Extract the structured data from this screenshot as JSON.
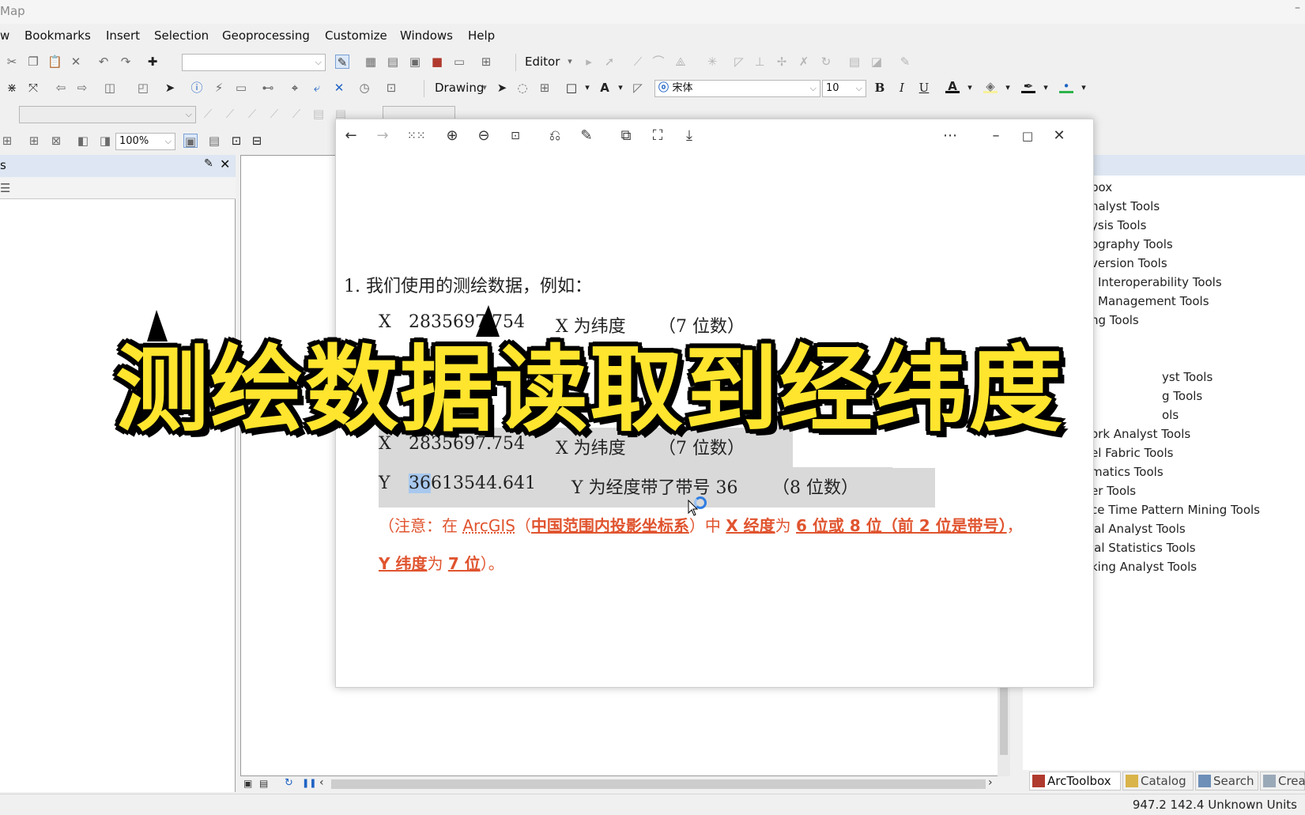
{
  "window": {
    "title": "Map",
    "minimize_glyph": "–"
  },
  "menu": [
    "w",
    "Bookmarks",
    "Insert",
    "Selection",
    "Geoprocessing",
    "Customize",
    "Windows",
    "Help"
  ],
  "toolbar": {
    "editor_label": "Editor",
    "drawing_label": "Drawing",
    "font_name": "宋体",
    "font_size": "10",
    "bold": "B",
    "italic": "I",
    "underline": "U",
    "zoom_percent": "100%"
  },
  "left_panel": {
    "title": "s"
  },
  "toolbox": {
    "items": [
      "box",
      "nalyst Tools",
      "ysis Tools",
      "ography Tools",
      "version Tools",
      "Interoperability Tools",
      "Management Tools",
      "ng Tools",
      "yst Tools",
      "g Tools",
      "ols",
      "ork Analyst Tools",
      "el Fabric Tools",
      "matics Tools",
      "er Tools",
      "ce Time Pattern Mining Tools",
      "ial Analyst Tools",
      "ial Statistics Tools",
      "king Analyst Tools"
    ],
    "tabs": [
      "ArcToolbox",
      "Catalog",
      "Search",
      "Crea"
    ]
  },
  "status": {
    "coords": "947.2  142.4 Unknown Units"
  },
  "document": {
    "line1": "1.   我们使用的测绘数据，例如：",
    "x_label": "X",
    "x_value": "2835697.754",
    "x_desc": "X 为纬度",
    "x_digits": "（7 位数）",
    "x2_value": "2835697.754",
    "x2_desc": "X 为纬度",
    "x2_digits": "（7 位数）",
    "y_label": "Y",
    "y_value_sel": "36",
    "y_value_rest": "613544.641",
    "y_desc": "Y 为经度带了带号 36",
    "y_digits": "（8 位数）",
    "note_1a": "（注意：在 ",
    "note_1b": "ArcGIS",
    "note_1c": "（",
    "note_1d": "中国范围内投影坐标系",
    "note_1e": "）中 ",
    "note_1f": "X 经度",
    "note_1g": "为 ",
    "note_1h": "6 位或 8 位（前 2 位是带号）",
    "note_1i": "，",
    "note_2a": "Y 纬度",
    "note_2b": "为 ",
    "note_2c": "7 位",
    "note_2d": "）。"
  },
  "banner": {
    "text": "测绘数据读取到经纬度"
  },
  "colors": {
    "banner": "#ffe52e",
    "note": "#e0542f",
    "selection": "#a8c8ee"
  }
}
